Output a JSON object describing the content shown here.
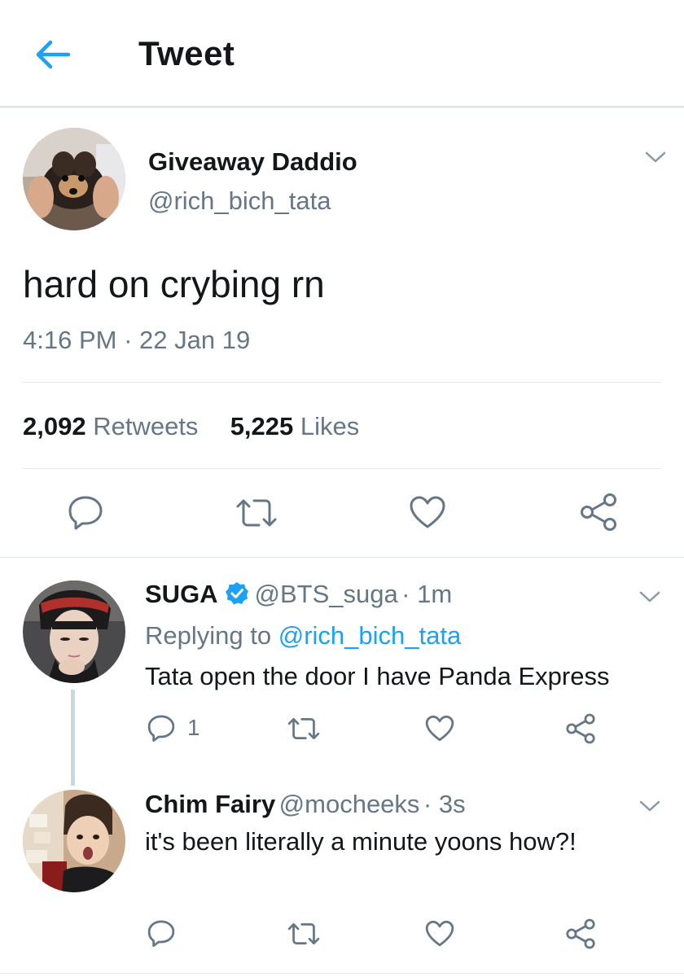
{
  "header": {
    "title": "Tweet"
  },
  "main_tweet": {
    "display_name": "Giveaway Daddio",
    "handle": "@rich_bich_tata",
    "text": "hard on crybing rn",
    "time": "4:16 PM",
    "separator": "·",
    "date": "22 Jan 19",
    "retweets_count": "2,092",
    "retweets_label": "Retweets",
    "likes_count": "5,225",
    "likes_label": "Likes"
  },
  "replies": [
    {
      "display_name": "SUGA",
      "verified": true,
      "handle": "@BTS_suga",
      "age": "· 1m",
      "replying_prefix": "Replying to",
      "replying_handle": "@rich_bich_tata",
      "text": "Tata open the door I have Panda Express",
      "reply_count": "1"
    },
    {
      "display_name": "Chim Fairy",
      "handle": "@mocheeks",
      "age": "· 3s",
      "text": "it's been literally a minute yoons how?!"
    }
  ],
  "colors": {
    "accent": "#1da1f2",
    "secondary_text": "#657786",
    "primary_text": "#14171a",
    "divider": "#e1e8ed"
  },
  "icons": [
    "back-arrow-icon",
    "chevron-down-icon",
    "reply-icon",
    "retweet-icon",
    "like-icon",
    "share-icon",
    "verified-badge-icon"
  ]
}
